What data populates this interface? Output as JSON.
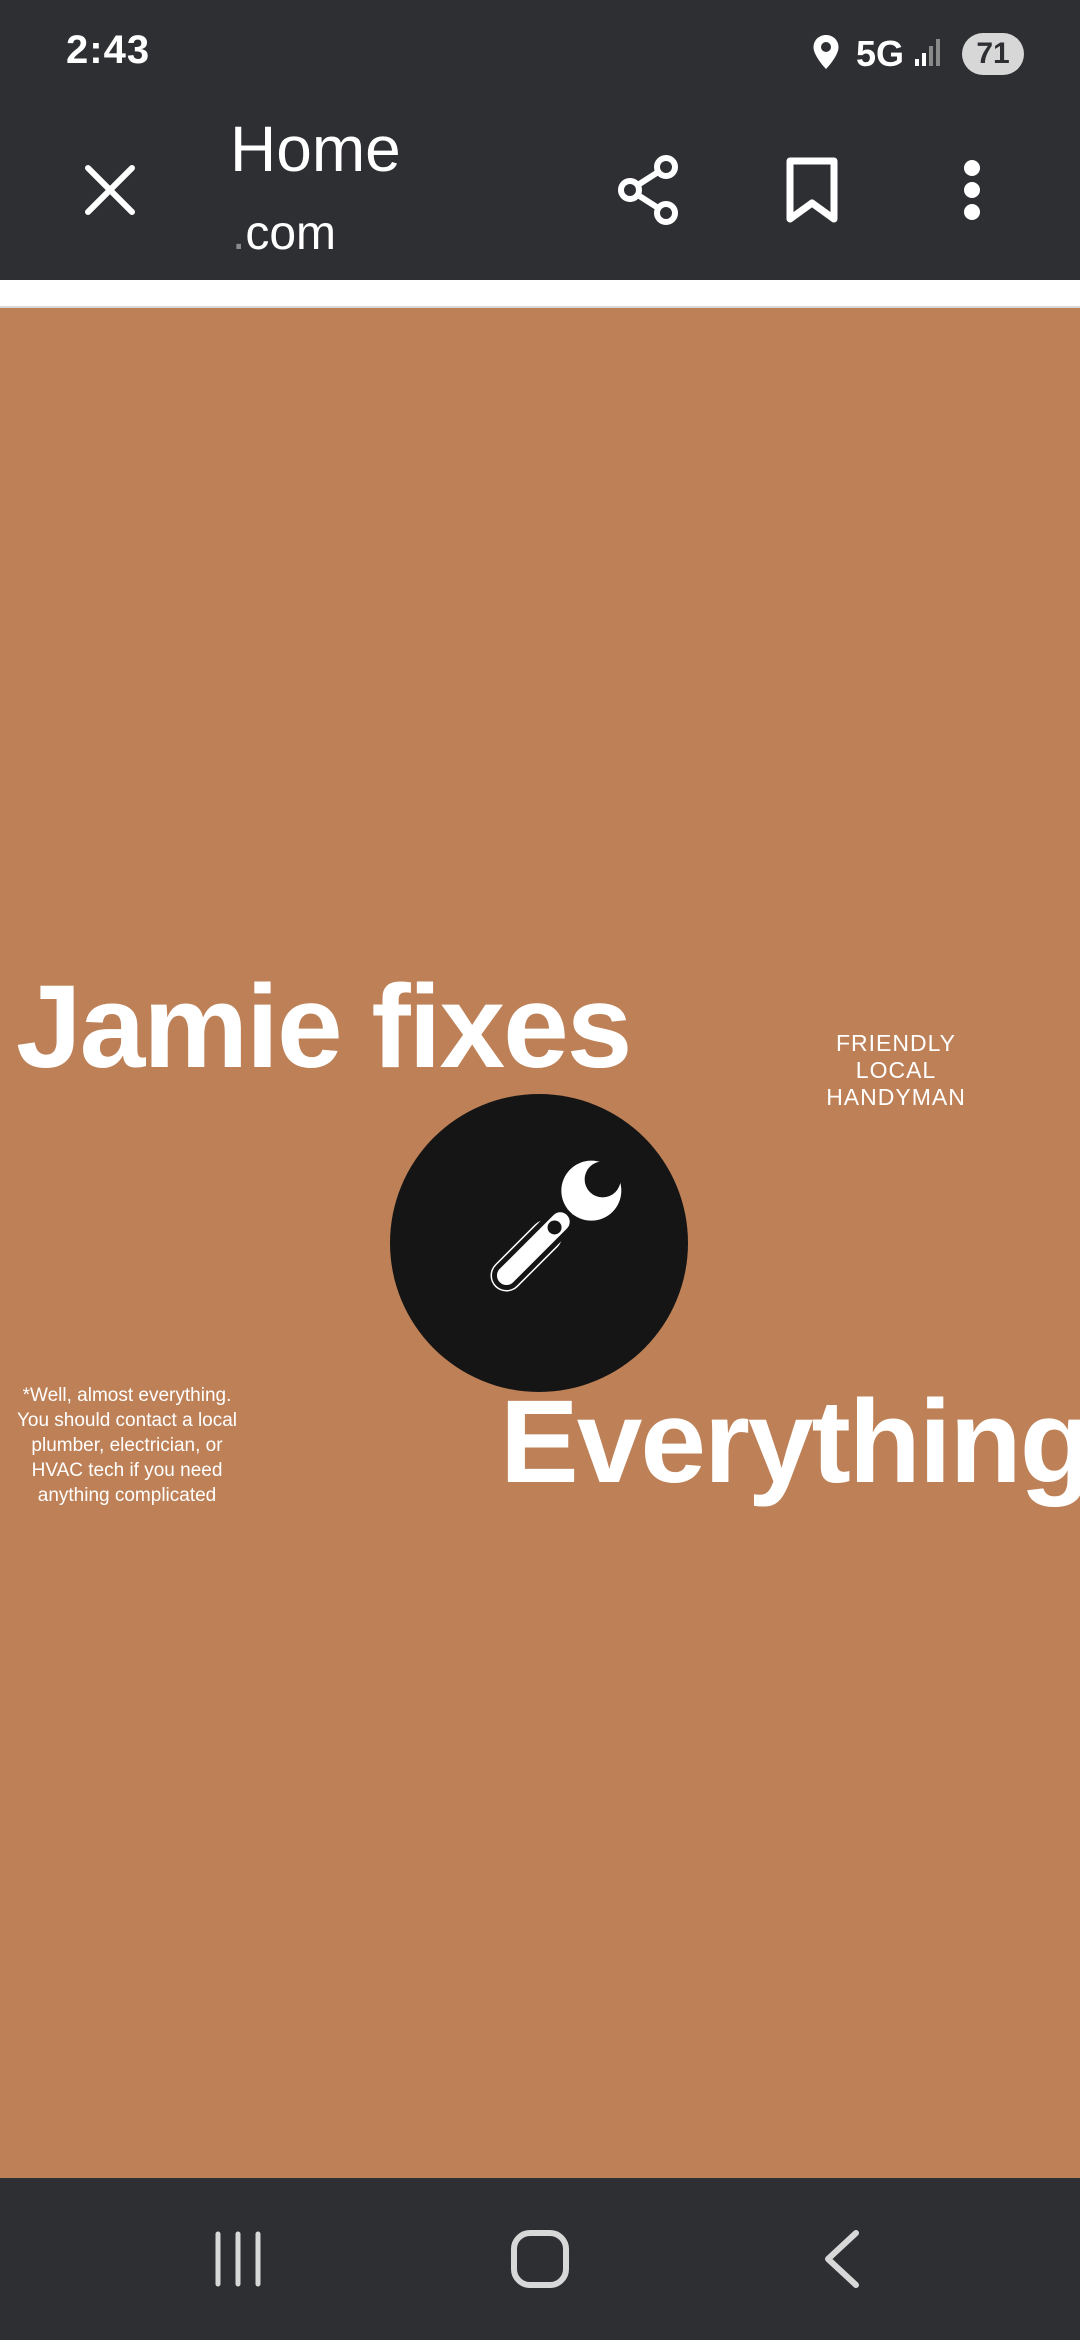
{
  "status_bar": {
    "time": "2:43",
    "network": "5G",
    "battery": "71",
    "icons": [
      "location-icon",
      "signal-icon"
    ]
  },
  "browser": {
    "title": "Home",
    "domain_dot": ".",
    "domain_suffix": "com",
    "icons": [
      "close-icon",
      "share-icon",
      "bookmark-icon",
      "more-vert-icon"
    ]
  },
  "page": {
    "background_color": "#be8057",
    "headline_line1": "Jamie fixes",
    "headline_line2": "Everything*",
    "tagline_line1": "FRIENDLY",
    "tagline_line2": "LOCAL",
    "tagline_line3": "HANDYMAN",
    "footnote": "*Well, almost everything. You should contact a local plumber, electrician, or HVAC tech if you need anything complicated",
    "logo_icon": "tools-icon",
    "logo_color": "#151515"
  },
  "nav_bar": {
    "icons": [
      "recents-icon",
      "home-icon",
      "back-icon"
    ]
  }
}
